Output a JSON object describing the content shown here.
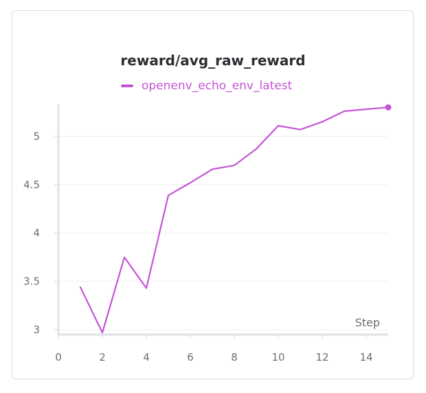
{
  "chart_data": {
    "type": "line",
    "title": "reward/avg_raw_reward",
    "xlabel": "Step",
    "ylabel": "",
    "xlim": [
      0,
      15
    ],
    "ylim": [
      2.95,
      5.33
    ],
    "xticks": [
      0,
      2,
      4,
      6,
      8,
      10,
      12,
      14
    ],
    "yticks": [
      3,
      3.5,
      4,
      4.5,
      5
    ],
    "xtick_labels": [
      "0",
      "2",
      "4",
      "6",
      "8",
      "10",
      "12",
      "14"
    ],
    "ytick_labels": [
      "3",
      "3.5",
      "4",
      "4.5",
      "5"
    ],
    "grid": true,
    "legend_position": "top-center",
    "series": [
      {
        "name": "openenv_echo_env_latest",
        "color": "#c553d6",
        "x": [
          1,
          2,
          3,
          4,
          5,
          6,
          7,
          8,
          9,
          10,
          11,
          12,
          13,
          14,
          15
        ],
        "y": [
          3.44,
          2.97,
          3.75,
          3.43,
          4.39,
          4.52,
          4.66,
          4.7,
          4.87,
          5.11,
          5.07,
          5.15,
          5.26,
          5.28,
          5.3
        ]
      }
    ]
  },
  "colors": {
    "grid": "#eeeef0",
    "axis": "#e0e1e4",
    "text": "#6b6e75",
    "title": "#2b2d31"
  }
}
